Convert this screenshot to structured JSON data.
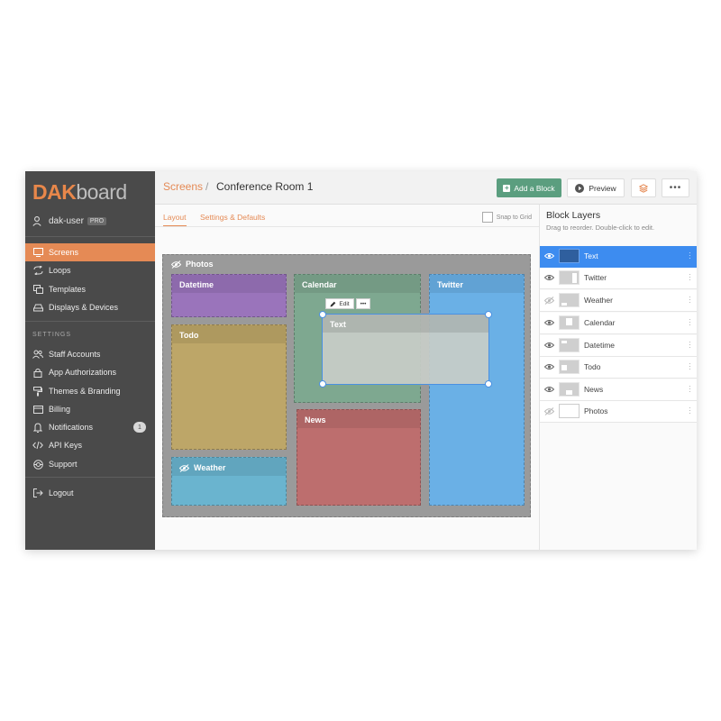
{
  "brand": {
    "logo_dak": "DAK",
    "logo_board": "board"
  },
  "user": {
    "name": "dak-user",
    "badge": "PRO"
  },
  "nav": {
    "screens": "Screens",
    "loops": "Loops",
    "templates": "Templates",
    "displays": "Displays & Devices"
  },
  "settings": {
    "section_label": "SETTINGS",
    "staff": "Staff Accounts",
    "app_auth": "App Authorizations",
    "themes": "Themes & Branding",
    "billing": "Billing",
    "notifications": "Notifications",
    "notifications_count": "1",
    "api_keys": "API Keys",
    "support": "Support"
  },
  "logout": "Logout",
  "header": {
    "crumb_root": "Screens",
    "crumb_sep": "/",
    "crumb_page": "Conference Room 1",
    "add_block": "Add a Block",
    "preview": "Preview",
    "more": "•••"
  },
  "tabs": {
    "layout": "Layout",
    "settings": "Settings & Defaults",
    "snap": "Snap to Grid"
  },
  "canvas": {
    "background_label": "Photos",
    "blocks": {
      "datetime": "Datetime",
      "todo": "Todo",
      "weather": "Weather",
      "calendar": "Calendar",
      "news": "News",
      "twitter": "Twitter",
      "text": "Text"
    },
    "edit_label": "Edit",
    "edit_more": "•••"
  },
  "colors": {
    "accent": "#e58a55",
    "sidebar_bg": "#4a4a4a",
    "add_block": "#5b9e7f",
    "selection": "#3d8cf0",
    "datetime": "#9a74bb",
    "todo": "#bda668",
    "weather": "#6ab4cf",
    "calendar": "#7ea890",
    "news": "#bd6e6e",
    "twitter": "#6ab0e6"
  },
  "layers_panel": {
    "title": "Block Layers",
    "subtitle": "Drag to reorder. Double-click to edit.",
    "items": [
      {
        "name": "Text",
        "visible": true,
        "selected": true
      },
      {
        "name": "Twitter",
        "visible": true
      },
      {
        "name": "Weather",
        "visible": false
      },
      {
        "name": "Calendar",
        "visible": true
      },
      {
        "name": "Datetime",
        "visible": true
      },
      {
        "name": "Todo",
        "visible": true
      },
      {
        "name": "News",
        "visible": true
      },
      {
        "name": "Photos",
        "visible": false
      }
    ]
  }
}
